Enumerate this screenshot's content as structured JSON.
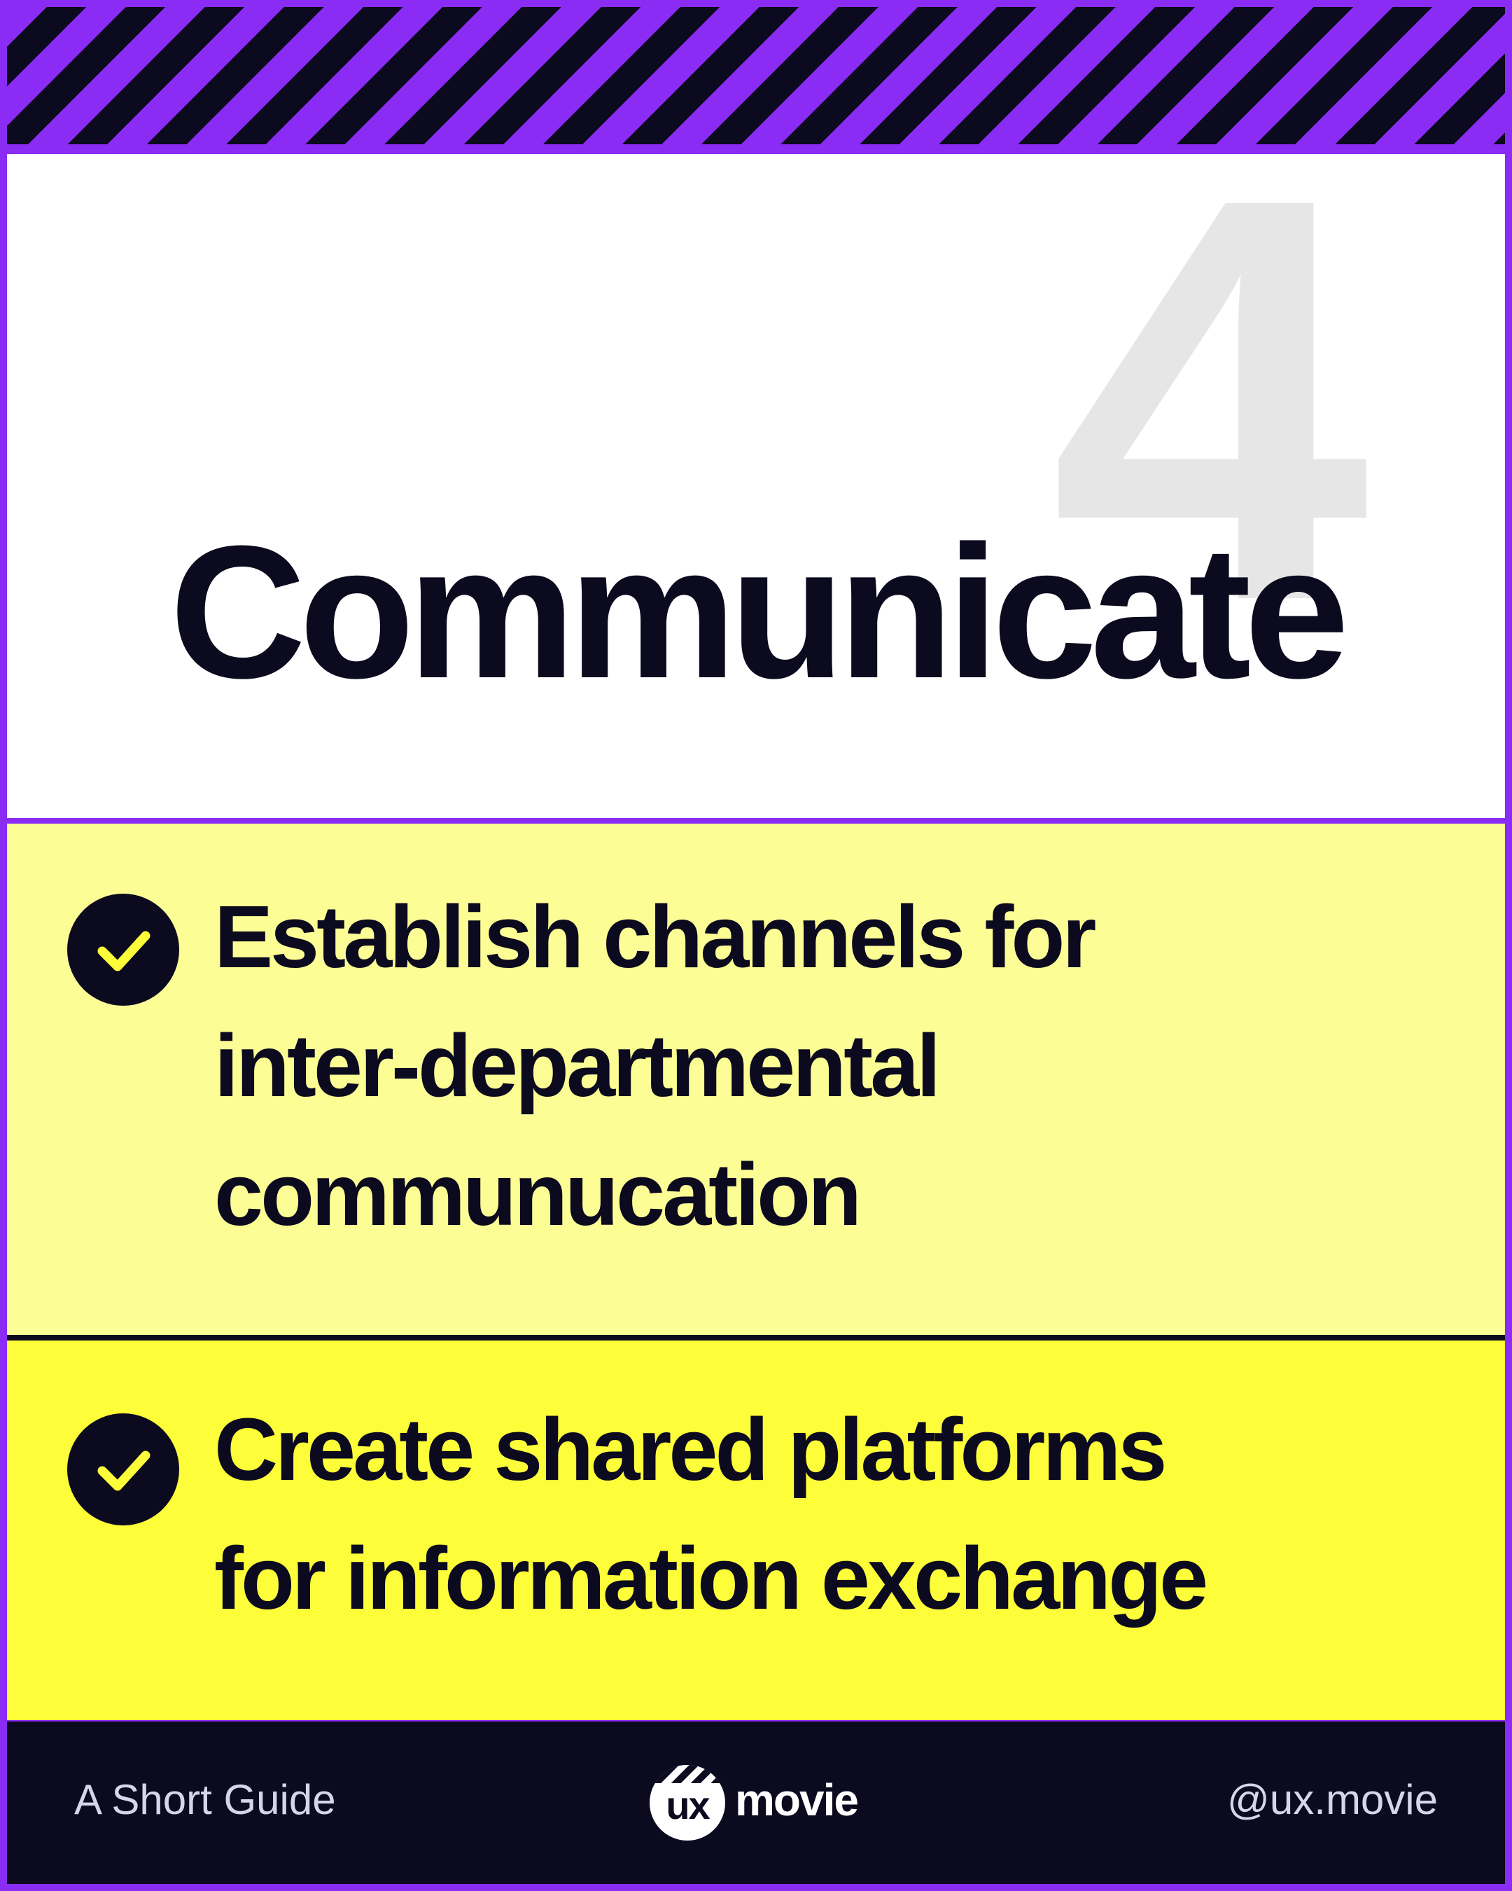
{
  "header": {
    "step_number": "4",
    "title": "Communicate"
  },
  "items": [
    {
      "icon": "check-circle-icon",
      "lines": [
        "Establish channels for",
        "inter-departmental",
        "communucation"
      ]
    },
    {
      "icon": "check-circle-icon",
      "lines": [
        "Create shared platforms",
        "for information exchange"
      ]
    }
  ],
  "footer": {
    "left_text": "A Short Guide",
    "logo_badge_text": "ux",
    "logo_word": "movie",
    "handle": "@ux.movie"
  },
  "colors": {
    "frame": "#8b2cf5",
    "dark": "#0b0a1e",
    "item_1_bg": "#fdfd96",
    "item_2_bg": "#fdfd3a",
    "check_mark": "#fdfd3a"
  }
}
